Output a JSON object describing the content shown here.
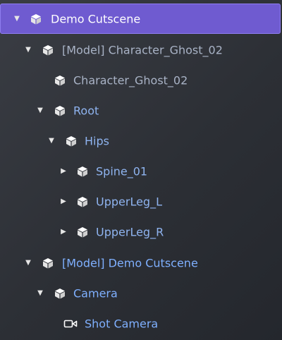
{
  "tree": {
    "nodes": [
      {
        "label": "Demo Cutscene",
        "expanded": true,
        "icon": "cube-icon",
        "selected": true
      },
      {
        "label": "[Model] Character_Ghost_02",
        "expanded": true,
        "icon": "cube-icon"
      },
      {
        "label": "Character_Ghost_02",
        "icon": "cube-icon"
      },
      {
        "label": "Root",
        "expanded": true,
        "icon": "cube-icon"
      },
      {
        "label": "Hips",
        "expanded": true,
        "icon": "cube-icon"
      },
      {
        "label": "Spine_01",
        "expanded": false,
        "icon": "cube-icon"
      },
      {
        "label": "UpperLeg_L",
        "expanded": false,
        "icon": "cube-icon"
      },
      {
        "label": "UpperLeg_R",
        "expanded": false,
        "icon": "cube-icon"
      },
      {
        "label": "[Model] Demo Cutscene",
        "expanded": true,
        "icon": "cube-icon"
      },
      {
        "label": "Camera",
        "expanded": true,
        "icon": "cube-icon"
      },
      {
        "label": "Shot Camera",
        "icon": "camera-icon"
      }
    ]
  },
  "colors": {
    "selected_row": "#6f5bd0",
    "label_blue": "#7fb0ff",
    "label_grey": "#a9b3c6",
    "background": "#2c2f35"
  }
}
